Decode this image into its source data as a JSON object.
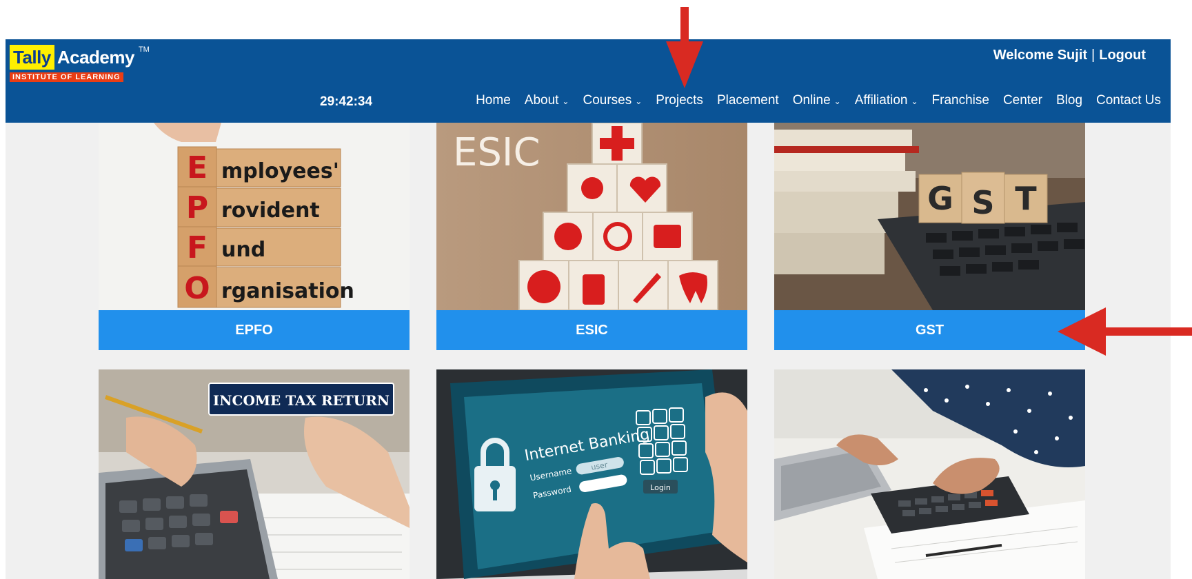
{
  "header": {
    "logo": {
      "brand_first": "Tally",
      "brand_second": "Academy",
      "trademark": "TM",
      "tagline": "INSTITUTE OF LEARNING"
    },
    "welcome_text": "Welcome Sujit",
    "separator": "|",
    "logout_label": "Logout",
    "clock": "29:42:34",
    "nav": [
      {
        "label": "Home",
        "dropdown": false
      },
      {
        "label": "About",
        "dropdown": true
      },
      {
        "label": "Courses",
        "dropdown": true
      },
      {
        "label": "Projects",
        "dropdown": false
      },
      {
        "label": "Placement",
        "dropdown": false
      },
      {
        "label": "Online",
        "dropdown": true
      },
      {
        "label": "Affiliation",
        "dropdown": true
      },
      {
        "label": "Franchise",
        "dropdown": false
      },
      {
        "label": "Center",
        "dropdown": false
      },
      {
        "label": "Blog",
        "dropdown": false
      },
      {
        "label": "Contact Us",
        "dropdown": false
      }
    ]
  },
  "cards": [
    {
      "label": "EPFO",
      "image_text": [
        "E",
        "mployees'",
        "P",
        "rovident",
        "F",
        "und",
        "O",
        "rganisation"
      ]
    },
    {
      "label": "ESIC",
      "image_text": "ESIC"
    },
    {
      "label": "GST",
      "image_text": [
        "G",
        "S",
        "T"
      ]
    },
    {
      "image_text": "INCOME TAX RETURN"
    },
    {
      "image_text": {
        "title": "Internet Banking",
        "username": "Username",
        "password": "Password",
        "user_value": "user",
        "login": "Login"
      }
    },
    {}
  ],
  "colors": {
    "header_bg": "#0a5396",
    "card_label_bg": "#2190ec",
    "arrow": "#d92a22",
    "logo_yellow": "#ffef00",
    "logo_orange": "#ea3d14"
  }
}
